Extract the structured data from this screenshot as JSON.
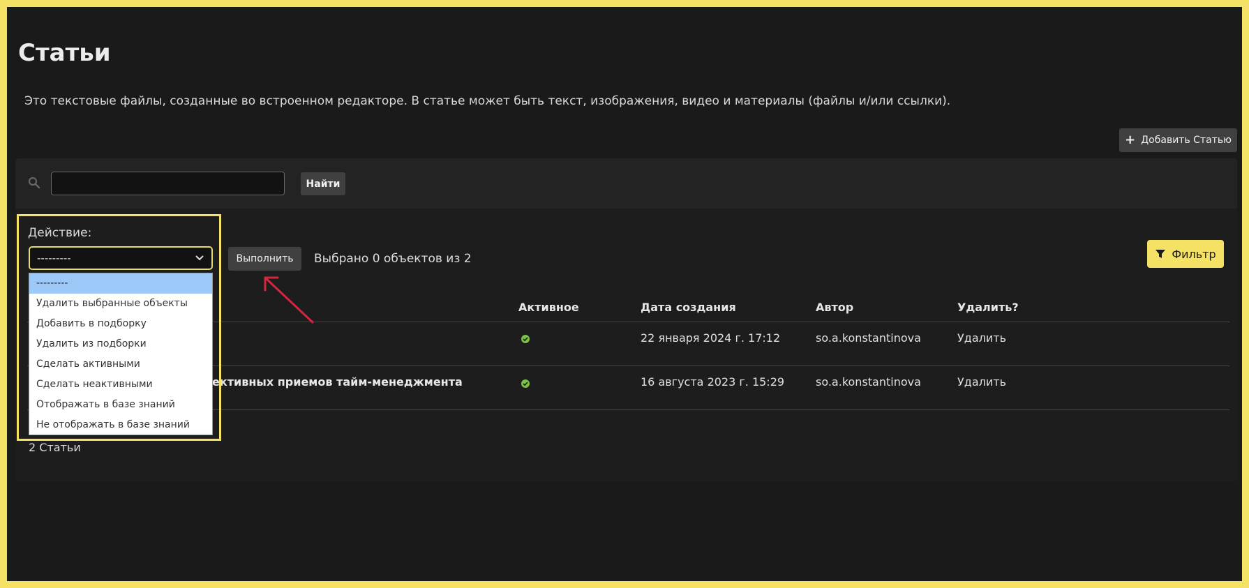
{
  "header": {
    "title": "Статьи",
    "description": "Это текстовые файлы, созданные во встроенном редакторе. В статье может быть текст, изображения, видео и материалы (файлы и/или ссылки).",
    "add_button": "Добавить Статью"
  },
  "search": {
    "value": "",
    "button": "Найти"
  },
  "actions": {
    "label": "Действие:",
    "selected": "---------",
    "options": [
      "---------",
      "Удалить выбранные объекты",
      "Добавить в подборку",
      "Удалить из подборки",
      "Сделать активными",
      "Сделать неактивными",
      "Отображать в базе знаний",
      "Не отображать в базе знаний"
    ],
    "execute_button": "Выполнить",
    "selected_count": "Выбрано 0 объектов из 2"
  },
  "filter": {
    "label": "Фильтр"
  },
  "table": {
    "columns": [
      "Активное",
      "Дата создания",
      "Автор",
      "Удалить?"
    ],
    "rows": [
      {
        "title": "",
        "active": true,
        "created": "22 января 2024 г. 17:12",
        "author": "so.a.konstantinova",
        "delete": "Удалить"
      },
      {
        "title": "ективных приемов тайм-менеджмента",
        "active": true,
        "created": "16 августа 2023 г. 15:29",
        "author": "so.a.konstantinova",
        "delete": "Удалить"
      }
    ]
  },
  "total": "2 Статьи",
  "colors": {
    "background": "#1a1a1a",
    "accent": "#f5e264",
    "active_check": "#7cc242",
    "dropdown_selected": "#9dc9f8",
    "arrow": "#d4263e"
  },
  "icons": [
    "search-icon",
    "plus-icon",
    "chevron-down-icon",
    "filter-icon",
    "check-circle-icon",
    "red-arrow-annotation"
  ]
}
